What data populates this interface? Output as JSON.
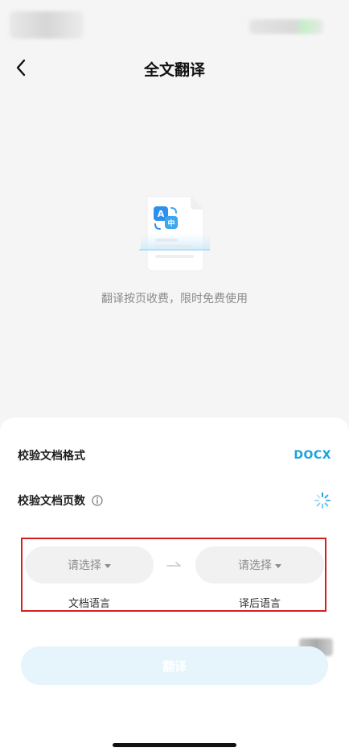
{
  "navbar": {
    "title": "全文翻译"
  },
  "illustration": {
    "hint": "翻译按页收费，限时免费使用"
  },
  "checks": {
    "format_label": "校验文档格式",
    "format_value": "DOCX",
    "pages_label": "校验文档页数"
  },
  "languages": {
    "source_placeholder": "请选择",
    "source_label": "文档语言",
    "target_placeholder": "请选择",
    "target_label": "译后语言"
  },
  "actions": {
    "translate_label": "翻译"
  },
  "colors": {
    "accent": "#1aa3e0",
    "button_bg": "#e6f4fc",
    "highlight_border": "#d51f1f"
  }
}
